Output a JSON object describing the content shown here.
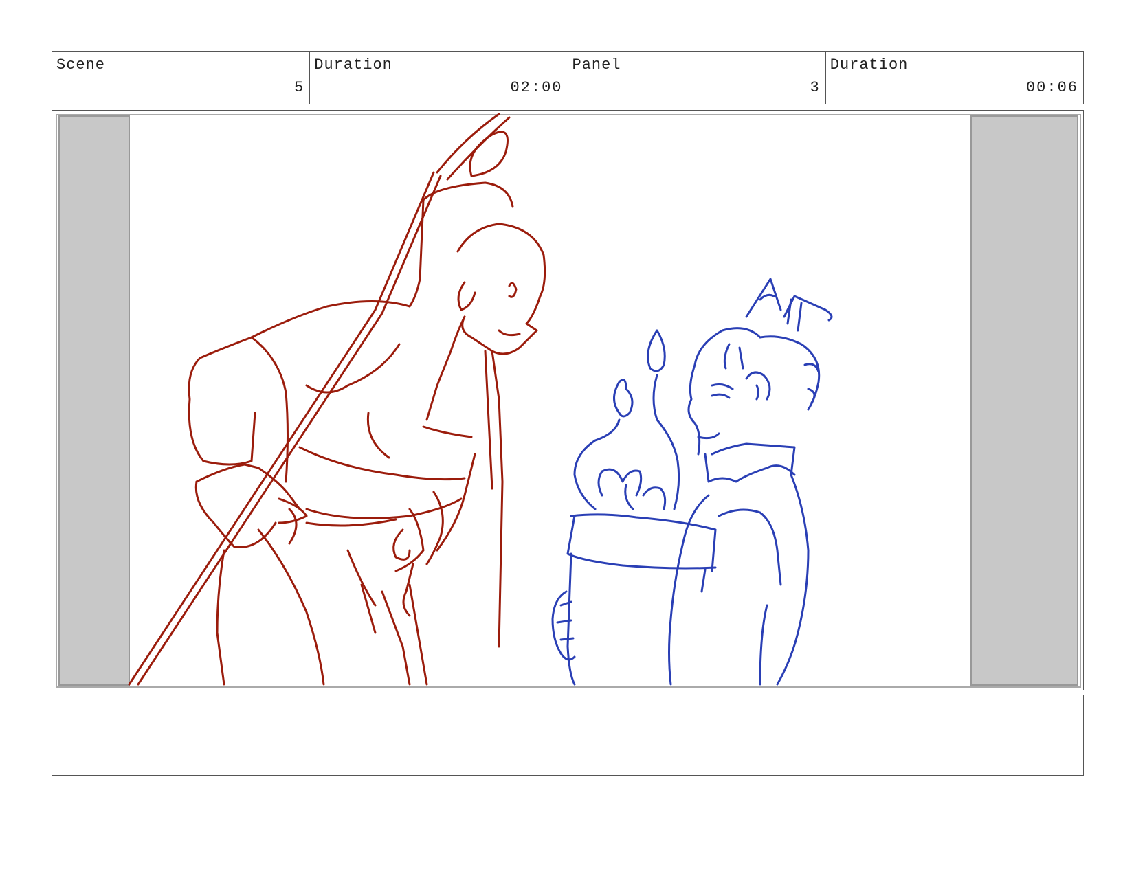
{
  "header": {
    "scene_label": "Scene",
    "scene_value": "5",
    "scene_duration_label": "Duration",
    "scene_duration_value": "02:00",
    "panel_label": "Panel",
    "panel_value": "3",
    "panel_duration_label": "Duration",
    "panel_duration_value": "00:06"
  },
  "colors": {
    "red_sketch": "#9b1c0c",
    "blue_sketch": "#2a3fb5",
    "safe_area_gray": "#c8c8c8",
    "border": "#555555"
  },
  "notes": {
    "text": ""
  }
}
